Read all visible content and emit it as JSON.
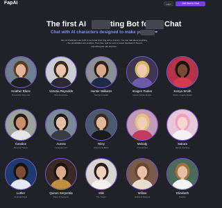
{
  "header": {
    "logo": "FapAI",
    "login_label": "Login",
    "join_label": "Join Now to Chat"
  },
  "hero": {
    "title_part1": "The first AI",
    "title_part2": "ting Bot for",
    "title_part3": "Chat",
    "subtitle": "Chat with AI characters designed to make you",
    "description": "Our AI characters are built to be better than ting with a human. You can talk about anything – the possibilities are endless. Here live, and be sure to leave feedback if there's something we can improve."
  },
  "characters": [
    {
      "name": "Heather Blaze",
      "role": "Domination Dirty Girl",
      "bg": "#6e7f94",
      "skin": "#e2b59a",
      "hair": "#5a3a22",
      "cloth": "#1e1e24"
    },
    {
      "name": "Victoria Reynolds",
      "role": "Boss Executive",
      "bg": "#c9cdd2",
      "skin": "#e8c4a8",
      "hair": "#3b2a1e",
      "cloth": "#2a2a30"
    },
    {
      "name": "Hunter Williams",
      "role": "Startup Founder",
      "bg": "#8a8f96",
      "skin": "#d7a98a",
      "hair": "#2b1f18",
      "cloth": "#1f2a44"
    },
    {
      "name": "Imogen Parker",
      "role": "Gamer Extraordinaire",
      "bg": "#3e3550",
      "skin": "#efc8b0",
      "hair": "#d9b56a",
      "cloth": "#6d5aa8"
    },
    {
      "name": "Kenya Smith",
      "role": "Ebony Lingerie Model",
      "bg": "#b8324a",
      "skin": "#7a4a32",
      "hair": "#1a120e",
      "cloth": "#d23a52"
    },
    {
      "name": "Candice",
      "role": "Personal Trainer",
      "bg": "#9aa39c",
      "skin": "#c88f6c",
      "hair": "#2a1a12",
      "cloth": "#e4e4e4"
    },
    {
      "name": "Aurora",
      "role": "Instagram Girl",
      "bg": "#7a8a98",
      "skin": "#e5bfa4",
      "hair": "#1e1a18",
      "cloth": "#3a3c44"
    },
    {
      "name": "Riley",
      "role": "Motorcycle Babe",
      "bg": "#4a5a6e",
      "skin": "#e0b89c",
      "hair": "#3a2a22",
      "cloth": "#1a1a1e"
    },
    {
      "name": "Melody",
      "role": "Cheerleader",
      "bg": "#c49ab8",
      "skin": "#f0cdb6",
      "hair": "#e4c27a",
      "cloth": "#c23a5e"
    },
    {
      "name": "Sakura",
      "role": "Hentai Goddess",
      "bg": "#e8c8d8",
      "skin": "#f4d8cc",
      "hair": "#f2a0c0",
      "cloth": "#f5f0f2"
    },
    {
      "name": "Luther",
      "role": "Football Player",
      "bg": "#1f3a6e",
      "skin": "#7a4e36",
      "hair": "#18120e",
      "cloth": "#e4e8f0"
    },
    {
      "name": "Queen Serpentia",
      "role": "Ruler of Serpents",
      "bg": "#3a2a24",
      "skin": "#d9a98a",
      "hair": "#1a1210",
      "cloth": "#c09040"
    },
    {
      "name": "Miki",
      "role": "The \"Virgin\"",
      "bg": "#d8d4d0",
      "skin": "#f0d0bc",
      "hair": "#2a1e1a",
      "cloth": "#f4f0ec"
    },
    {
      "name": "Willow",
      "role": "Girlfriend Material",
      "bg": "#7a5a48",
      "skin": "#e8c0a6",
      "hair": "#6a4630",
      "cloth": "#e8dccc"
    },
    {
      "name": "Elizabeth",
      "role": "Teacher",
      "bg": "#4a6a5a",
      "skin": "#e6c0a4",
      "hair": "#a07040",
      "cloth": "#f4f4f4"
    }
  ]
}
